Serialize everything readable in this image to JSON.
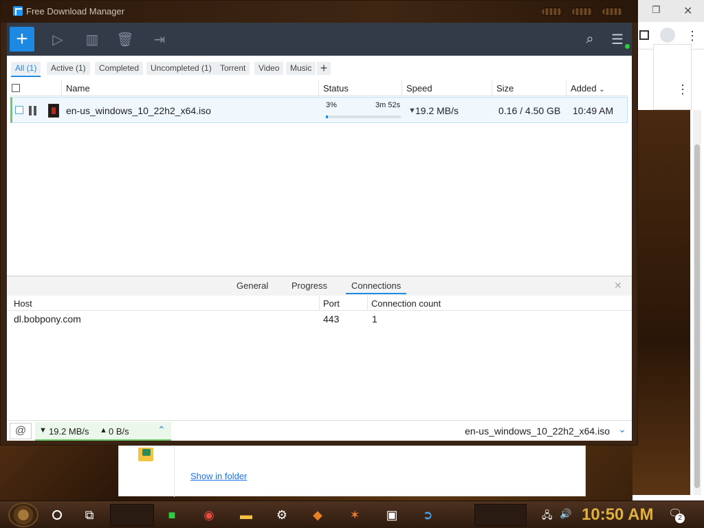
{
  "window": {
    "title": "Free Download Manager"
  },
  "filters": [
    {
      "label": "All (1)"
    },
    {
      "label": "Active (1)"
    },
    {
      "label": "Completed"
    },
    {
      "label": "Uncompleted (1)"
    },
    {
      "label": "Torrent"
    },
    {
      "label": "Video"
    },
    {
      "label": "Music"
    }
  ],
  "columns": {
    "name": "Name",
    "status": "Status",
    "speed": "Speed",
    "size": "Size",
    "added": "Added"
  },
  "download": {
    "file_name": "en-us_windows_10_22h2_x64.iso",
    "percent": "3%",
    "progress": 0.03,
    "time_left": "3m 52s",
    "speed": "19.2 MB/s",
    "size": "0.16 / 4.50 GB",
    "added": "10:49 AM"
  },
  "details": {
    "tabs": [
      "General",
      "Progress",
      "Connections"
    ],
    "active_tab": "Connections",
    "headers": {
      "host": "Host",
      "port": "Port",
      "count": "Connection count"
    },
    "connections": [
      {
        "host": "dl.bobpony.com",
        "port": "443",
        "count": "1"
      }
    ]
  },
  "statusbar": {
    "down_speed": "19.2 MB/s",
    "up_speed": "0 B/s",
    "current_file": "en-us_windows_10_22h2_x64.iso"
  },
  "browser_shelf": {
    "show_folder": "Show in folder"
  },
  "taskbar": {
    "clock": "10:50 AM",
    "notification_count": "2"
  },
  "colors": {
    "accent": "#1e88e5",
    "toolbar": "#333b49",
    "active_green": "#6cc86c",
    "clock": "#e0b040"
  },
  "icons": [
    "play-schedule-icon",
    "columns-icon",
    "trash-icon",
    "move-to-folder-icon",
    "search-icon",
    "menu-icon",
    "snail-icon",
    "chevron-up-icon",
    "chevron-down-icon"
  ]
}
